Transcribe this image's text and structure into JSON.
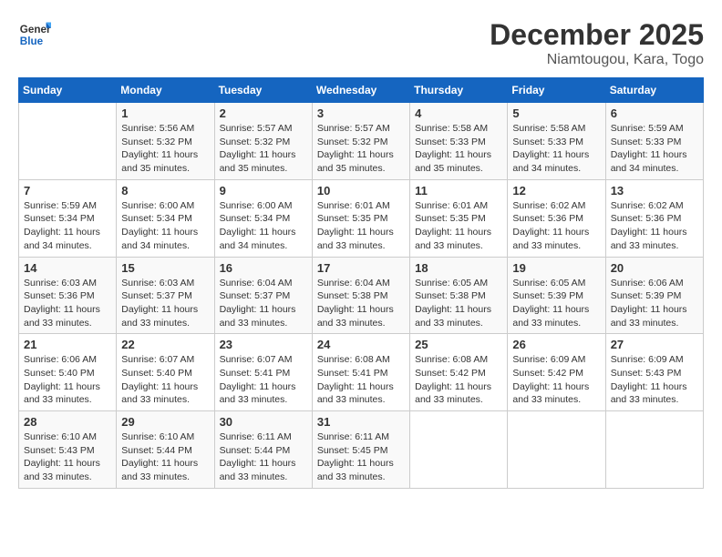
{
  "header": {
    "logo_line1": "General",
    "logo_line2": "Blue",
    "month_title": "December 2025",
    "location": "Niamtougou, Kara, Togo"
  },
  "weekdays": [
    "Sunday",
    "Monday",
    "Tuesday",
    "Wednesday",
    "Thursday",
    "Friday",
    "Saturday"
  ],
  "weeks": [
    [
      {
        "day": "",
        "sunrise": "",
        "sunset": "",
        "daylight": ""
      },
      {
        "day": "1",
        "sunrise": "Sunrise: 5:56 AM",
        "sunset": "Sunset: 5:32 PM",
        "daylight": "Daylight: 11 hours and 35 minutes."
      },
      {
        "day": "2",
        "sunrise": "Sunrise: 5:57 AM",
        "sunset": "Sunset: 5:32 PM",
        "daylight": "Daylight: 11 hours and 35 minutes."
      },
      {
        "day": "3",
        "sunrise": "Sunrise: 5:57 AM",
        "sunset": "Sunset: 5:32 PM",
        "daylight": "Daylight: 11 hours and 35 minutes."
      },
      {
        "day": "4",
        "sunrise": "Sunrise: 5:58 AM",
        "sunset": "Sunset: 5:33 PM",
        "daylight": "Daylight: 11 hours and 35 minutes."
      },
      {
        "day": "5",
        "sunrise": "Sunrise: 5:58 AM",
        "sunset": "Sunset: 5:33 PM",
        "daylight": "Daylight: 11 hours and 34 minutes."
      },
      {
        "day": "6",
        "sunrise": "Sunrise: 5:59 AM",
        "sunset": "Sunset: 5:33 PM",
        "daylight": "Daylight: 11 hours and 34 minutes."
      }
    ],
    [
      {
        "day": "7",
        "sunrise": "Sunrise: 5:59 AM",
        "sunset": "Sunset: 5:34 PM",
        "daylight": "Daylight: 11 hours and 34 minutes."
      },
      {
        "day": "8",
        "sunrise": "Sunrise: 6:00 AM",
        "sunset": "Sunset: 5:34 PM",
        "daylight": "Daylight: 11 hours and 34 minutes."
      },
      {
        "day": "9",
        "sunrise": "Sunrise: 6:00 AM",
        "sunset": "Sunset: 5:34 PM",
        "daylight": "Daylight: 11 hours and 34 minutes."
      },
      {
        "day": "10",
        "sunrise": "Sunrise: 6:01 AM",
        "sunset": "Sunset: 5:35 PM",
        "daylight": "Daylight: 11 hours and 33 minutes."
      },
      {
        "day": "11",
        "sunrise": "Sunrise: 6:01 AM",
        "sunset": "Sunset: 5:35 PM",
        "daylight": "Daylight: 11 hours and 33 minutes."
      },
      {
        "day": "12",
        "sunrise": "Sunrise: 6:02 AM",
        "sunset": "Sunset: 5:36 PM",
        "daylight": "Daylight: 11 hours and 33 minutes."
      },
      {
        "day": "13",
        "sunrise": "Sunrise: 6:02 AM",
        "sunset": "Sunset: 5:36 PM",
        "daylight": "Daylight: 11 hours and 33 minutes."
      }
    ],
    [
      {
        "day": "14",
        "sunrise": "Sunrise: 6:03 AM",
        "sunset": "Sunset: 5:36 PM",
        "daylight": "Daylight: 11 hours and 33 minutes."
      },
      {
        "day": "15",
        "sunrise": "Sunrise: 6:03 AM",
        "sunset": "Sunset: 5:37 PM",
        "daylight": "Daylight: 11 hours and 33 minutes."
      },
      {
        "day": "16",
        "sunrise": "Sunrise: 6:04 AM",
        "sunset": "Sunset: 5:37 PM",
        "daylight": "Daylight: 11 hours and 33 minutes."
      },
      {
        "day": "17",
        "sunrise": "Sunrise: 6:04 AM",
        "sunset": "Sunset: 5:38 PM",
        "daylight": "Daylight: 11 hours and 33 minutes."
      },
      {
        "day": "18",
        "sunrise": "Sunrise: 6:05 AM",
        "sunset": "Sunset: 5:38 PM",
        "daylight": "Daylight: 11 hours and 33 minutes."
      },
      {
        "day": "19",
        "sunrise": "Sunrise: 6:05 AM",
        "sunset": "Sunset: 5:39 PM",
        "daylight": "Daylight: 11 hours and 33 minutes."
      },
      {
        "day": "20",
        "sunrise": "Sunrise: 6:06 AM",
        "sunset": "Sunset: 5:39 PM",
        "daylight": "Daylight: 11 hours and 33 minutes."
      }
    ],
    [
      {
        "day": "21",
        "sunrise": "Sunrise: 6:06 AM",
        "sunset": "Sunset: 5:40 PM",
        "daylight": "Daylight: 11 hours and 33 minutes."
      },
      {
        "day": "22",
        "sunrise": "Sunrise: 6:07 AM",
        "sunset": "Sunset: 5:40 PM",
        "daylight": "Daylight: 11 hours and 33 minutes."
      },
      {
        "day": "23",
        "sunrise": "Sunrise: 6:07 AM",
        "sunset": "Sunset: 5:41 PM",
        "daylight": "Daylight: 11 hours and 33 minutes."
      },
      {
        "day": "24",
        "sunrise": "Sunrise: 6:08 AM",
        "sunset": "Sunset: 5:41 PM",
        "daylight": "Daylight: 11 hours and 33 minutes."
      },
      {
        "day": "25",
        "sunrise": "Sunrise: 6:08 AM",
        "sunset": "Sunset: 5:42 PM",
        "daylight": "Daylight: 11 hours and 33 minutes."
      },
      {
        "day": "26",
        "sunrise": "Sunrise: 6:09 AM",
        "sunset": "Sunset: 5:42 PM",
        "daylight": "Daylight: 11 hours and 33 minutes."
      },
      {
        "day": "27",
        "sunrise": "Sunrise: 6:09 AM",
        "sunset": "Sunset: 5:43 PM",
        "daylight": "Daylight: 11 hours and 33 minutes."
      }
    ],
    [
      {
        "day": "28",
        "sunrise": "Sunrise: 6:10 AM",
        "sunset": "Sunset: 5:43 PM",
        "daylight": "Daylight: 11 hours and 33 minutes."
      },
      {
        "day": "29",
        "sunrise": "Sunrise: 6:10 AM",
        "sunset": "Sunset: 5:44 PM",
        "daylight": "Daylight: 11 hours and 33 minutes."
      },
      {
        "day": "30",
        "sunrise": "Sunrise: 6:11 AM",
        "sunset": "Sunset: 5:44 PM",
        "daylight": "Daylight: 11 hours and 33 minutes."
      },
      {
        "day": "31",
        "sunrise": "Sunrise: 6:11 AM",
        "sunset": "Sunset: 5:45 PM",
        "daylight": "Daylight: 11 hours and 33 minutes."
      },
      {
        "day": "",
        "sunrise": "",
        "sunset": "",
        "daylight": ""
      },
      {
        "day": "",
        "sunrise": "",
        "sunset": "",
        "daylight": ""
      },
      {
        "day": "",
        "sunrise": "",
        "sunset": "",
        "daylight": ""
      }
    ]
  ]
}
